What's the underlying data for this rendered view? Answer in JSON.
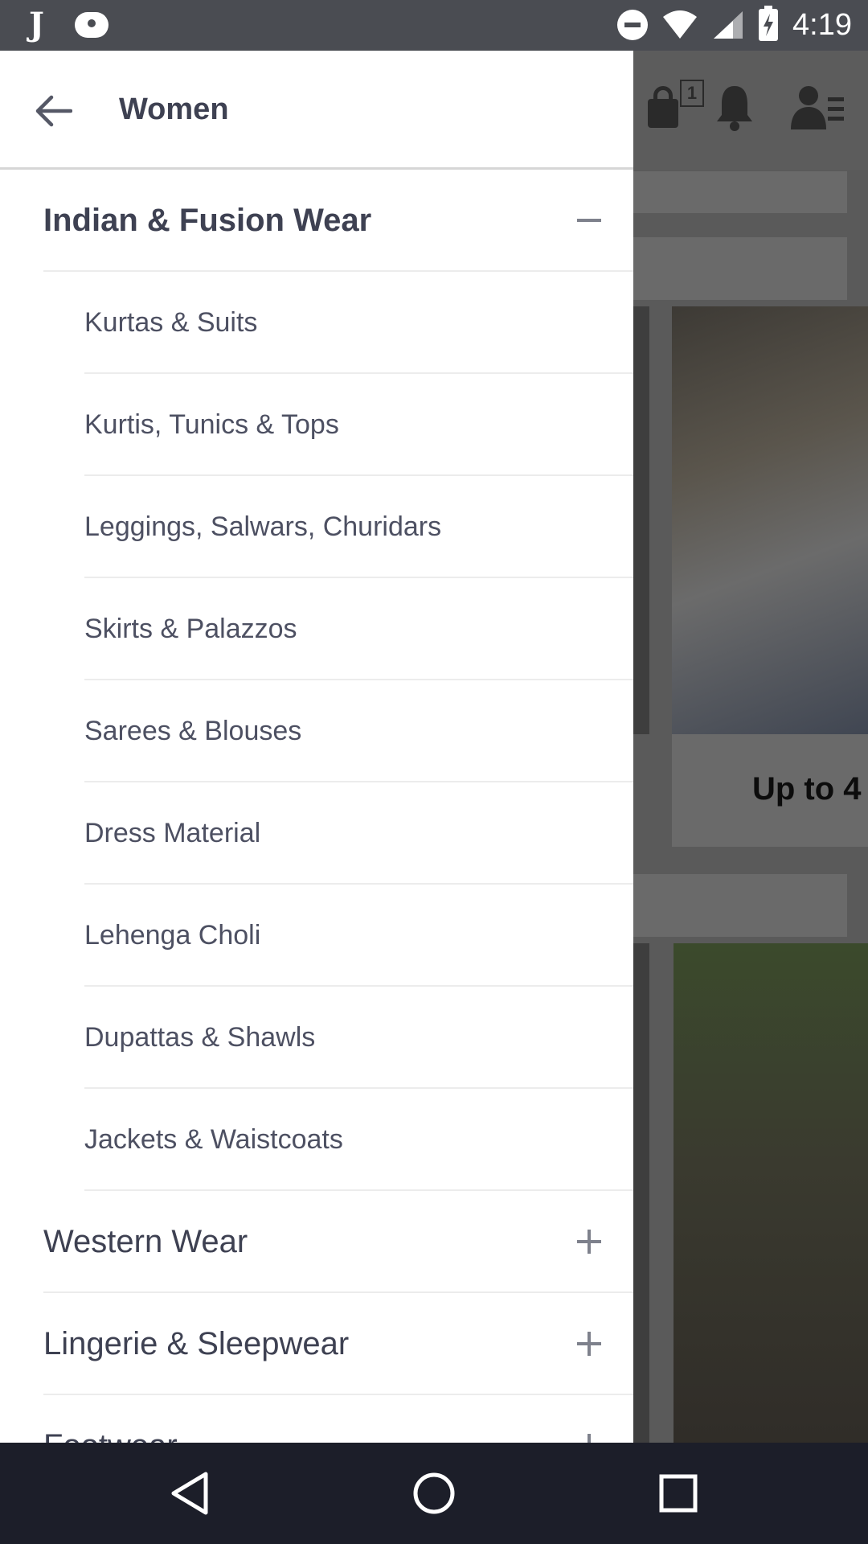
{
  "status_bar": {
    "time": "4:19",
    "left_icons": [
      "j-app-icon",
      "chat-icon"
    ],
    "right_icons": [
      "do-not-disturb-icon",
      "wifi-icon",
      "signal-icon",
      "battery-charging-icon"
    ]
  },
  "drawer": {
    "title": "Women",
    "categories": [
      {
        "label": "Indian & Fusion Wear",
        "expanded": true,
        "toggle_icon": "minus-icon",
        "subcategories": [
          "Kurtas & Suits",
          "Kurtis, Tunics & Tops",
          "Leggings, Salwars, Churidars",
          "Skirts & Palazzos",
          "Sarees & Blouses",
          "Dress Material",
          "Lehenga Choli",
          "Dupattas & Shawls",
          "Jackets & Waistcoats"
        ]
      },
      {
        "label": "Western Wear",
        "expanded": false,
        "toggle_icon": "plus-icon"
      },
      {
        "label": "Lingerie & Sleepwear",
        "expanded": false,
        "toggle_icon": "plus-icon"
      },
      {
        "label": "Footwear",
        "expanded": false,
        "toggle_icon": "plus-icon"
      }
    ]
  },
  "background_app": {
    "bag_count": "1",
    "banner_text": "Up to 4"
  },
  "colors": {
    "drawer_text": "#3e4152",
    "status_bar": "#4a4c52",
    "nav_bar": "#1c1e29",
    "divider": "#ececec"
  }
}
